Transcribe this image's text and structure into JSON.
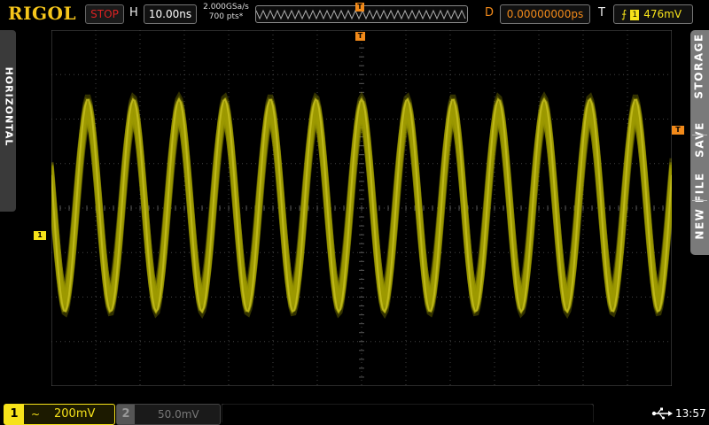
{
  "brand": "RIGOL",
  "top": {
    "run_status": "STOP",
    "timebase_label": "H",
    "timebase_value": "10.00ns",
    "sample_rate": "2.000GSa/s",
    "memory_depth": "700 pts*",
    "delay_label": "D",
    "delay_value": "0.00000000ps",
    "trigger_label": "T",
    "trigger_source": "1",
    "trigger_level": "476mV",
    "trigger_marker": "T",
    "trigger_slope_icon": "rising-edge-icon"
  },
  "side": {
    "left_tab": "HORIZONTAL",
    "right_menu": [
      "NEW FILE",
      "SAVE",
      "STORAGE"
    ]
  },
  "markers": {
    "ch1": "1",
    "trigger_level": "T",
    "trigger_position": "T"
  },
  "bottom": {
    "ch1": {
      "number": "1",
      "coupling": "~",
      "scale": "200mV"
    },
    "ch2": {
      "number": "2",
      "scale": "50.0mV"
    },
    "usb_icon": "usb-icon",
    "clock": "13:57"
  },
  "colors": {
    "ch1": "#f6e21a",
    "trace": "#a09a00",
    "trigger": "#f28a1a",
    "stop": "#dd2222",
    "logo": "#f6c61b"
  }
}
